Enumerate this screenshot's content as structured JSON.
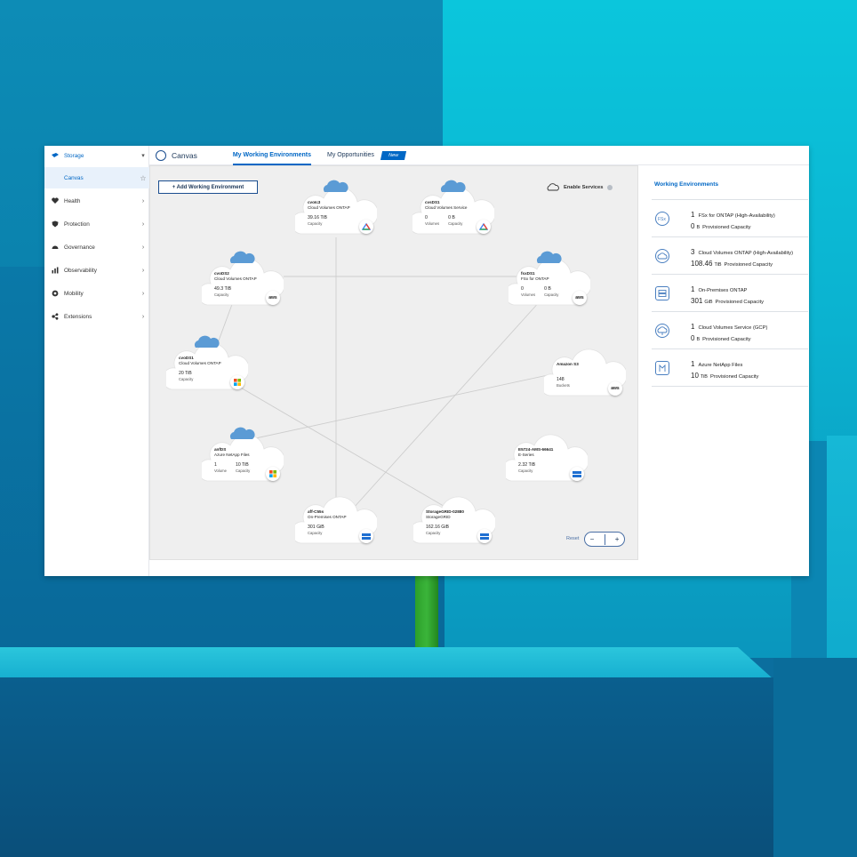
{
  "sidebar": {
    "items": [
      {
        "label": "Storage",
        "icon": "storage-icon"
      },
      {
        "label": "Health",
        "icon": "health-icon"
      },
      {
        "label": "Protection",
        "icon": "protection-icon"
      },
      {
        "label": "Governance",
        "icon": "governance-icon"
      },
      {
        "label": "Observability",
        "icon": "observability-icon"
      },
      {
        "label": "Mobility",
        "icon": "mobility-icon"
      },
      {
        "label": "Extensions",
        "icon": "extensions-icon"
      }
    ],
    "sub_item": "Canvas"
  },
  "topbar": {
    "title": "Canvas",
    "tabs": [
      "My Working Environments",
      "My Opportunities"
    ],
    "new_badge": "New"
  },
  "canvas": {
    "add_button": "+ Add Working Environment",
    "enable_services": "Enable Services",
    "reset": "Reset",
    "zoom_out": "−",
    "zoom_in": "+",
    "nodes": [
      {
        "name": "cvoIc3",
        "type": "Cloud Volumes ONTAP",
        "metrics": [
          {
            "v": "39.16 TiB",
            "l": "Capacity"
          }
        ],
        "provider": "gcp"
      },
      {
        "name": "cvsDS1",
        "type": "Cloud Volumes Service",
        "metrics": [
          {
            "v": "0",
            "l": "Volumes"
          },
          {
            "v": "0 B",
            "l": "Capacity"
          }
        ],
        "provider": "gcp"
      },
      {
        "name": "cvoDS2",
        "type": "Cloud Volumes ONTAP",
        "metrics": [
          {
            "v": "49.3 TiB",
            "l": "Capacity"
          }
        ],
        "provider": "aws"
      },
      {
        "name": "fsxDS1",
        "type": "FSx for ONTAP",
        "metrics": [
          {
            "v": "0",
            "l": "Volumes"
          },
          {
            "v": "0 B",
            "l": "Capacity"
          }
        ],
        "provider": "aws"
      },
      {
        "name": "cvoDS1",
        "type": "Cloud Volumes ONTAP",
        "metrics": [
          {
            "v": "20 TiB",
            "l": "Capacity"
          }
        ],
        "provider": "azure"
      },
      {
        "name": "Amazon S3",
        "type": "",
        "metrics": [
          {
            "v": "148",
            "l": "Buckets"
          }
        ],
        "provider": "aws"
      },
      {
        "name": "anfDS",
        "type": "Azure NetApp Files",
        "metrics": [
          {
            "v": "1",
            "l": "Volume"
          },
          {
            "v": "10 TiB",
            "l": "Capacity"
          }
        ],
        "provider": "azure"
      },
      {
        "name": "E5724-AMS-66641",
        "type": "E-Series",
        "metrics": [
          {
            "v": "2.32 TiB",
            "l": "Capacity"
          }
        ],
        "provider": "onprem"
      },
      {
        "name": "aff-C55s",
        "type": "On-Premises ONTAP",
        "metrics": [
          {
            "v": "301 GiB",
            "l": "Capacity"
          }
        ],
        "provider": "onprem"
      },
      {
        "name": "StorageGRID-02880",
        "type": "StorageGRID",
        "metrics": [
          {
            "v": "162.16 GiB",
            "l": "Capacity"
          }
        ],
        "provider": "onprem"
      }
    ]
  },
  "working_environments": {
    "title": "Working Environments",
    "items": [
      {
        "count": "1",
        "label": "FSx for ONTAP (High-Availability)",
        "value": "0",
        "unit": "B",
        "suffix": "Provisioned Capacity",
        "icon": "fsx-icon"
      },
      {
        "count": "3",
        "label": "Cloud Volumes ONTAP (High-Availability)",
        "value": "108.46",
        "unit": "TiB",
        "suffix": "Provisioned Capacity",
        "icon": "cloud-icon"
      },
      {
        "count": "1",
        "label": "On-Premises ONTAP",
        "value": "301",
        "unit": "GiB",
        "suffix": "Provisioned Capacity",
        "icon": "server-icon"
      },
      {
        "count": "1",
        "label": "Cloud Volumes Service (GCP)",
        "value": "0",
        "unit": "B",
        "suffix": "Provisioned Capacity",
        "icon": "cloud-service-icon"
      },
      {
        "count": "1",
        "label": "Azure NetApp Files",
        "value": "10",
        "unit": "TiB",
        "suffix": "Provisioned Capacity",
        "icon": "anf-icon"
      }
    ]
  },
  "colors": {
    "accent": "#0067c5",
    "canvas_bg": "#efefef",
    "azure_tile": "#f25022"
  }
}
